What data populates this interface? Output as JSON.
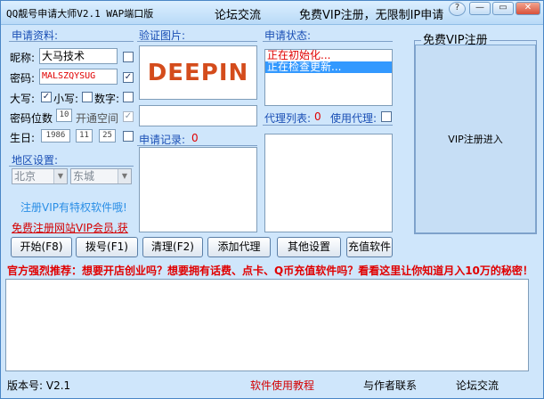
{
  "title_bar": {
    "app_title": "QQ靓号申请大师V2.1 WAP端口版",
    "forum_link": "论坛交流",
    "promo": "免费VIP注册，无限制IP申请",
    "help_label": "?",
    "min_label": "—",
    "max_label": "▭",
    "close_label": "✕"
  },
  "apply_info": {
    "section": "申请资料:",
    "nickname_label": "昵称:",
    "nickname_value": "大马技术",
    "password_label": "密码:",
    "password_value": "MALSZQYSUG",
    "uppercase_label": "大写:",
    "lowercase_label": "小写:",
    "digits_label": "数字:",
    "pwd_len_label": "密码位数",
    "pwd_len_value": "10",
    "open_space_label": "开通空间",
    "birthday_label": "生日:",
    "birth_year": "1986",
    "birth_month": "11",
    "birth_day": "25",
    "check_mark": "✓"
  },
  "region": {
    "section": "地区设置:",
    "province": "北京",
    "city": "东城",
    "arrow": "▼"
  },
  "captcha": {
    "section": "验证图片:",
    "image_text": "DEEPIN"
  },
  "records": {
    "label": "申请记录:",
    "count": "0"
  },
  "status": {
    "section": "申请状态:",
    "lines": [
      "正在初始化...",
      "正在检查更新..."
    ]
  },
  "proxy": {
    "list_label": "代理列表:",
    "list_count": "0",
    "use_label": "使用代理:"
  },
  "vip": {
    "group_title": "免费VIP注册",
    "enter_button": "VIP注册进入"
  },
  "promo_links": {
    "vip_privilege": "注册VIP有特权软件哦!",
    "free_register": "免费注册网站VIP会员,获"
  },
  "buttons": {
    "start": "开始(F8)",
    "dial": "拨号(F1)",
    "clear": "清理(F2)",
    "add_proxy": "添加代理",
    "other_settings": "其他设置",
    "recharge": "充值软件"
  },
  "ad_text": "官方强烈推荐：想要开店创业吗？想要拥有话费、点卡、Q币充值软件吗？看看这里让你知道月入10万的秘密！",
  "footer": {
    "version": "版本号: V2.1",
    "tutorial": "软件使用教程",
    "contact": "与作者联系",
    "forum": "论坛交流"
  },
  "colors": {
    "window_bg": "#cfe6fb",
    "accent_blue": "#1a4fb5",
    "alert_red": "#e00000",
    "selection": "#3399ff"
  }
}
